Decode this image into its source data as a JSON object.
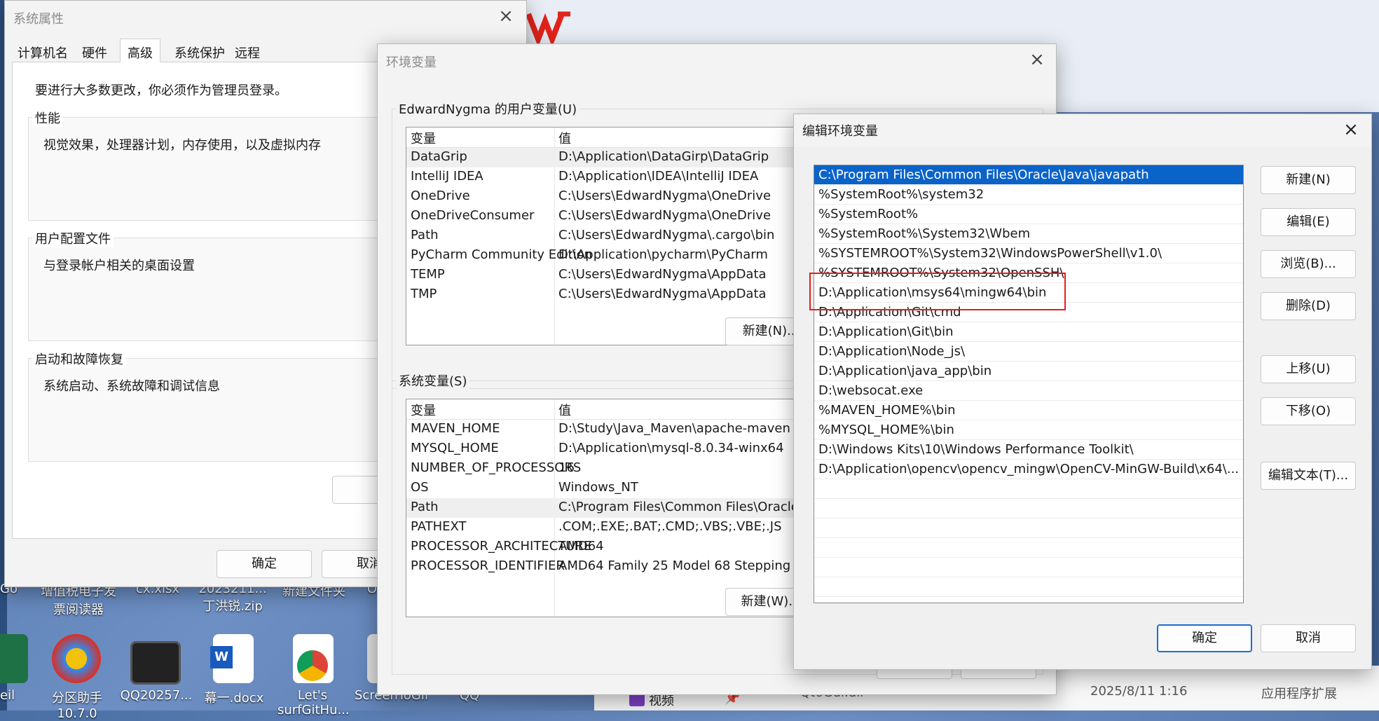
{
  "system_properties": {
    "title": "系统属性",
    "tabs": [
      "计算机名",
      "硬件",
      "高级",
      "系统保护",
      "远程"
    ],
    "active_tab": "高级",
    "admin_note": "要进行大多数更改，你必须作为管理员登录。",
    "groups": [
      {
        "title": "性能",
        "desc": "视觉效果，处理器计划，内存使用，以及虚拟内存"
      },
      {
        "title": "用户配置文件",
        "desc": "与登录帐户相关的桌面设置"
      },
      {
        "title": "启动和故障恢复",
        "desc": "系统启动、系统故障和调试信息"
      }
    ],
    "ok_label": "确定",
    "cancel_label": "取消"
  },
  "env_vars": {
    "title": "环境变量",
    "user_section": "EdwardNygma 的用户变量(U)",
    "col_var": "变量",
    "col_val": "值",
    "user_rows": [
      [
        "DataGrip",
        "D:\\Application\\DataGirp\\DataGrip"
      ],
      [
        "IntelliJ IDEA",
        "D:\\Application\\IDEA\\IntelliJ IDEA"
      ],
      [
        "OneDrive",
        "C:\\Users\\EdwardNygma\\OneDrive"
      ],
      [
        "OneDriveConsumer",
        "C:\\Users\\EdwardNygma\\OneDrive"
      ],
      [
        "Path",
        "C:\\Users\\EdwardNygma\\.cargo\\bin"
      ],
      [
        "PyCharm Community Edition",
        "D:\\Application\\pycharm\\PyCharm"
      ],
      [
        "TEMP",
        "C:\\Users\\EdwardNygma\\AppData"
      ],
      [
        "TMP",
        "C:\\Users\\EdwardNygma\\AppData"
      ]
    ],
    "user_new": "新建(N)...",
    "sys_section": "系统变量(S)",
    "sys_rows": [
      [
        "MAVEN_HOME",
        "D:\\Study\\Java_Maven\\apache-maven"
      ],
      [
        "MYSQL_HOME",
        "D:\\Application\\mysql-8.0.34-winx64"
      ],
      [
        "NUMBER_OF_PROCESSORS",
        "16"
      ],
      [
        "OS",
        "Windows_NT"
      ],
      [
        "Path",
        "C:\\Program Files\\Common Files\\Oracle"
      ],
      [
        "PATHEXT",
        ".COM;.EXE;.BAT;.CMD;.VBS;.VBE;.JS"
      ],
      [
        "PROCESSOR_ARCHITECTURE",
        "AMD64"
      ],
      [
        "PROCESSOR_IDENTIFIER",
        "AMD64 Family 25 Model 68 Stepping"
      ]
    ],
    "sys_new": "新建(W)..."
  },
  "edit_env": {
    "title": "编辑环境变量",
    "paths": [
      "C:\\Program Files\\Common Files\\Oracle\\Java\\javapath",
      "%SystemRoot%\\system32",
      "%SystemRoot%",
      "%SystemRoot%\\System32\\Wbem",
      "%SYSTEMROOT%\\System32\\WindowsPowerShell\\v1.0\\",
      "%SYSTEMROOT%\\System32\\OpenSSH\\",
      "D:\\Application\\msys64\\mingw64\\bin",
      "D:\\Application\\Git\\cmd",
      "D:\\Application\\Git\\bin",
      "D:\\Application\\Node_js\\",
      "D:\\Application\\java_app\\bin",
      "D:\\websocat.exe",
      "%MAVEN_HOME%\\bin",
      "%MYSQL_HOME%\\bin",
      "D:\\Windows Kits\\10\\Windows Performance Toolkit\\",
      "D:\\Application\\opencv\\opencv_mingw\\OpenCV-MinGW-Build\\x64\\..."
    ],
    "selected_index": 0,
    "highlighted_index": 6,
    "buttons": {
      "new": "新建(N)",
      "edit": "编辑(E)",
      "browse": "浏览(B)...",
      "delete": "删除(D)",
      "up": "上移(U)",
      "down": "下移(O)",
      "edit_text": "编辑文本(T)..."
    },
    "ok_label": "确定",
    "cancel_label": "取消",
    "highlight_color": "#e02020",
    "selection_color": "#0a63c9"
  },
  "desktop": {
    "top_labels": [
      "Go",
      "增值税电子发\n票阅读器",
      "cx.xlsx",
      "2023211...\n丁洪锐.zip",
      "新建文件夹",
      "O"
    ],
    "bottom_labels": [
      "eil",
      "分区助手\n10.7.0",
      "QQ20257...",
      "幕一.docx",
      "Let's\nsurfGitHu...",
      "ScreenToGif",
      "QQ"
    ]
  },
  "taskbar_partial": {
    "video_label": "视频",
    "file_label": "Qt6Gui.dll",
    "date": "2025/8/11 1:16",
    "type": "应用程序扩展"
  }
}
